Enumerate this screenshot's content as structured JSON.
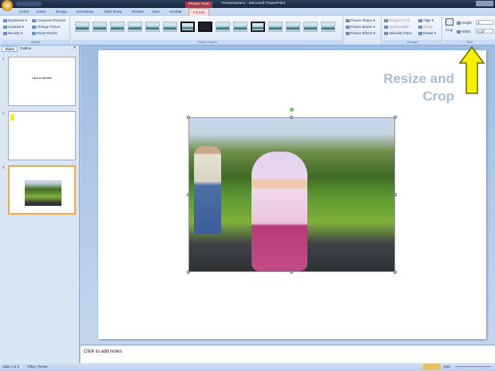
{
  "window": {
    "title": "Presentation1 - Microsoft PowerPoint",
    "context_tab": "Picture Tools"
  },
  "tabs": [
    "Home",
    "Insert",
    "Design",
    "Animations",
    "Slide Show",
    "Review",
    "View",
    "Acrobat",
    "Format"
  ],
  "active_tab": "Format",
  "ribbon": {
    "adjust": {
      "label": "Adjust",
      "items": [
        "Brightness",
        "Contrast",
        "Recolor",
        "Compress Pictures",
        "Change Picture",
        "Reset Picture"
      ]
    },
    "picture_styles": {
      "label": "Picture Styles",
      "items": [
        "Picture Shape",
        "Picture Border",
        "Picture Effects"
      ]
    },
    "arrange": {
      "label": "Arrange",
      "items": [
        "Bring to Front",
        "Send to Back",
        "Selection Pane",
        "Align",
        "Group",
        "Rotate"
      ]
    },
    "size": {
      "label": "Size",
      "crop": "Crop",
      "height_label": "Height:",
      "height_value": "4\"",
      "width_label": "Width:",
      "width_value": "5.33\""
    }
  },
  "panel": {
    "tabs": [
      "Slides",
      "Outline"
    ],
    "slide1_text": "Click to add title",
    "slide_numbers": [
      "1",
      "2",
      "3"
    ]
  },
  "slide": {
    "annotation_line1": "Resize and",
    "annotation_line2": "Crop"
  },
  "notes_placeholder": "Click to add notes",
  "status": {
    "slide": "Slide 3 of 3",
    "theme": "\"Office Theme\"",
    "zoom": "53%"
  },
  "colors": {
    "accent_arrow": "#f5f000",
    "annotation": "#a9bfd8"
  }
}
